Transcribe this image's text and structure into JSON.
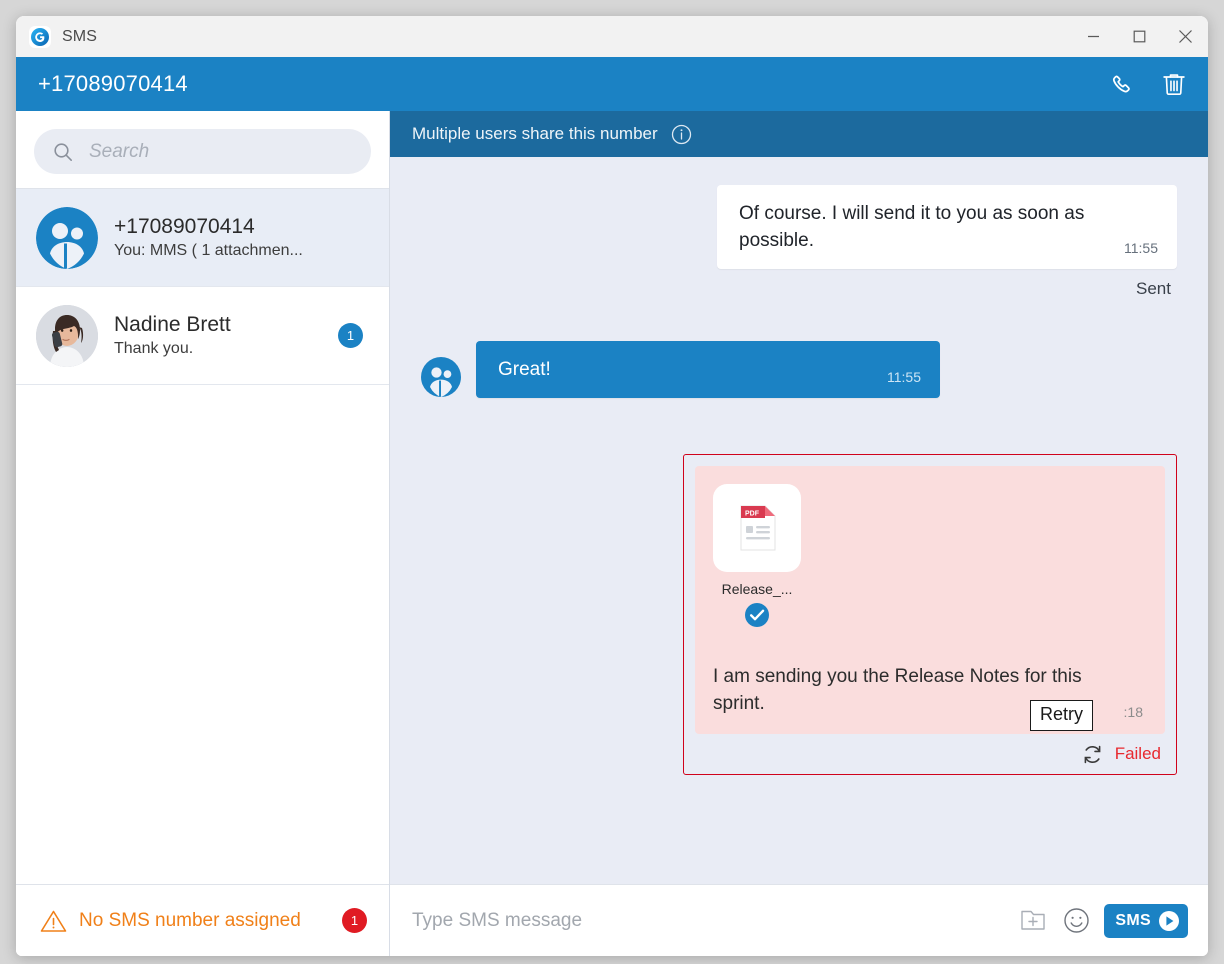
{
  "window": {
    "app_title": "SMS",
    "logo_icon": "g-logo-icon",
    "controls": {
      "minimize": "minimize-icon",
      "maximize": "maximize-icon",
      "close": "close-icon"
    }
  },
  "header": {
    "number": "+17089070414",
    "call_icon": "phone-icon",
    "delete_icon": "trash-icon"
  },
  "sidebar": {
    "search": {
      "value": "",
      "placeholder": "Search",
      "icon": "search-icon"
    },
    "conversations": [
      {
        "name": "+17089070414",
        "preview": "You: MMS ( 1 attachmen...",
        "avatar": "group-avatar-icon",
        "selected": true,
        "unread": ""
      },
      {
        "name": "Nadine Brett",
        "preview": "Thank you.",
        "avatar": "photo-avatar",
        "selected": false,
        "unread": "1"
      }
    ],
    "footer": {
      "warning_icon": "warning-triangle-icon",
      "warning_text": "No SMS number assigned",
      "badge": "1"
    }
  },
  "conversation": {
    "banner": {
      "text": "Multiple users share this number",
      "info_icon": "info-circle-icon"
    },
    "messages": [
      {
        "direction": "out",
        "kind": "text",
        "text": "Of course. I will send it to you as soon as possible.",
        "time": "11:55",
        "status": "Sent"
      },
      {
        "direction": "in",
        "kind": "text",
        "text": "Great!",
        "time": "11:55",
        "avatar": "group-avatar-icon"
      },
      {
        "direction": "out",
        "kind": "attachment-failed",
        "attachment": {
          "name": "Release_...",
          "type_label": "PDF",
          "thumb_icon": "pdf-file-icon",
          "check_icon": "check-circle-icon"
        },
        "text": "I am sending you the Release Notes for this sprint.",
        "time": ":18",
        "status": "Failed",
        "retry_icon": "retry-icon",
        "tooltip": "Retry"
      }
    ]
  },
  "composer": {
    "input_value": "",
    "placeholder": "Type SMS message",
    "attach_icon": "add-attachment-icon",
    "emoji_icon": "emoji-smiley-icon",
    "send_label": "SMS",
    "send_icon": "send-arrow-icon"
  },
  "colors": {
    "accent": "#1b82c4",
    "banner": "#1c6a9e",
    "failed": "#e8292f",
    "failed_border": "#d0021b",
    "failed_bubble": "#fadddd",
    "warning": "#f08019",
    "badge_red": "#e01b23",
    "message_bg": "#e9ecf5"
  }
}
